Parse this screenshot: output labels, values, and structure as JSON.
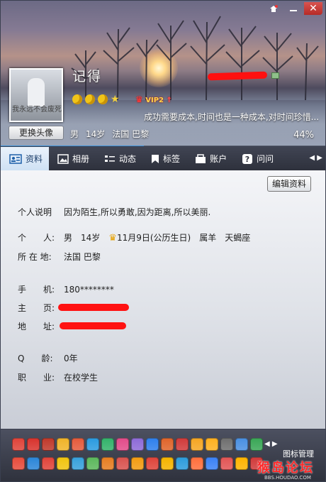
{
  "window": {
    "controls": [
      "skin-icon",
      "minimize-icon",
      "close-icon"
    ]
  },
  "profile": {
    "nickname": "记得",
    "avatar_caption": "我永远不会废死",
    "change_avatar_label": "更换头像",
    "level_icons": [
      "moon",
      "moon",
      "moon",
      "star"
    ],
    "vip_label": "VIP2",
    "vip_arrow": "↑",
    "signature": "成功需要成本,时间也是一种成本,对时间珍惜...",
    "gender": "男",
    "age": "14岁",
    "location": "法国 巴黎",
    "completion_text": "44%",
    "completion_value": 0.44
  },
  "tabs": [
    {
      "label": "资料",
      "icon": "profile-card-icon",
      "active": true
    },
    {
      "label": "相册",
      "icon": "photo-icon",
      "active": false
    },
    {
      "label": "动态",
      "icon": "feed-icon",
      "active": false
    },
    {
      "label": "标签",
      "icon": "bookmark-icon",
      "active": false
    },
    {
      "label": "账户",
      "icon": "wallet-icon",
      "active": false
    },
    {
      "label": "问问",
      "icon": "question-icon",
      "active": false
    }
  ],
  "tab_scroll": {
    "left": "◀",
    "right": "▶"
  },
  "details": {
    "edit_button": "编辑资料",
    "description_label": "个人说明",
    "description_value": "因为陌生,所以勇敢,因为距离,所以美丽.",
    "personal_label": "个　　人:",
    "personal_gender": "男",
    "personal_age": "14岁",
    "personal_birthday": "11月9日(公历生日)",
    "personal_zodiac": "属羊",
    "personal_star_sign": "天蝎座",
    "location_label": "所 在 地:",
    "location_value": "法国 巴黎",
    "phone_label": "手　　机:",
    "phone_value": "180********",
    "homepage_label": "主　　页:",
    "address_label": "地　　址:",
    "qage_label": "Q　　龄:",
    "qage_value": "0年",
    "job_label": "职　　业:",
    "job_value": "在校学生"
  },
  "footer": {
    "icon_manage_label": "图标管理",
    "scroll_left": "◀",
    "scroll_right": "▶",
    "watermark_main": "猴岛论坛",
    "watermark_sub": "BBS.HOUDAO.COM",
    "icon_colors": [
      "#e0443a",
      "#d8342e",
      "#c0392b",
      "#f0b429",
      "#e55b3c",
      "#2c9be0",
      "#34b36b",
      "#e34c8a",
      "#8e6bd8",
      "#2f80ed",
      "#e0652b",
      "#d13b3b",
      "#f5a623",
      "#ffb020",
      "#6f6f6f",
      "#4a90e2",
      "#3aa757",
      "#e74c3c",
      "#2c86d8",
      "#e0443a",
      "#f1c40f",
      "#38a1db",
      "#5cb85c",
      "#e67e22",
      "#d9534f",
      "#f39c12",
      "#e0443a",
      "#f4b400",
      "#2d9cdb",
      "#ff6f3c",
      "#3b82f6",
      "#e25555",
      "#ffb400",
      "#d13a3a"
    ]
  }
}
